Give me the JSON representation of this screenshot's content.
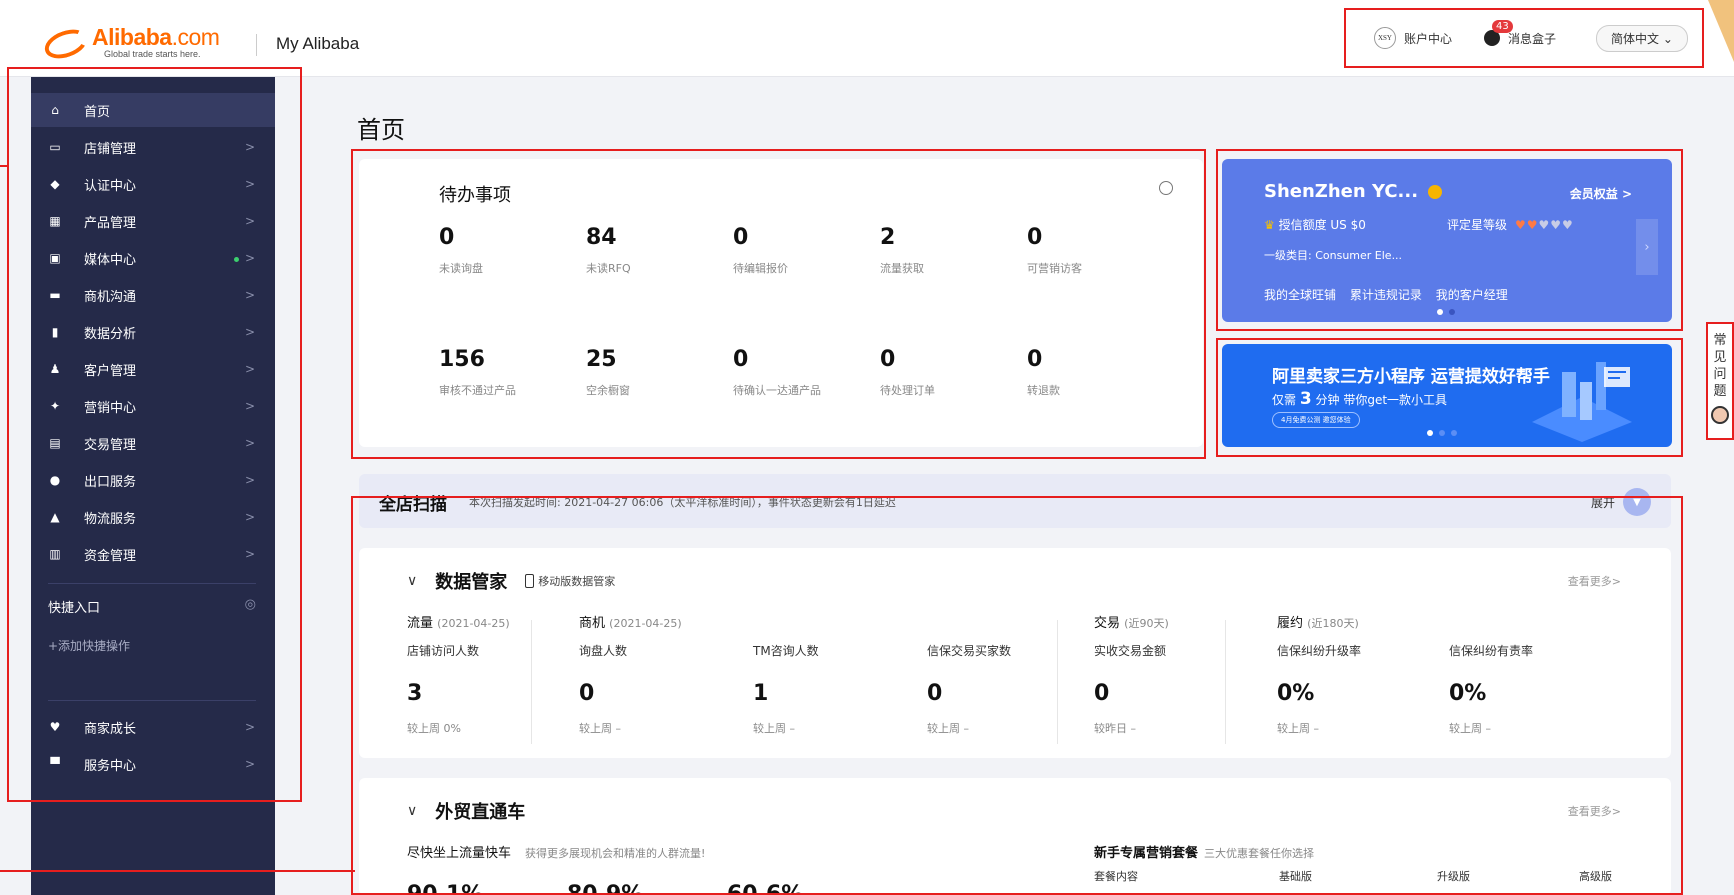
{
  "header": {
    "brand": "Alibaba",
    "brand_suffix": ".com",
    "slogan": "Global trade starts here.",
    "site_name": "My Alibaba",
    "account_avatar": "XSY",
    "account_label": "账户中心",
    "message_count": "43",
    "message_label": "消息盒子",
    "language": "简体中文"
  },
  "sidebar": {
    "items": [
      {
        "label": "首页",
        "icon": "home-icon",
        "glyph": "⌂"
      },
      {
        "label": "店铺管理",
        "icon": "store-icon",
        "glyph": "▭"
      },
      {
        "label": "认证中心",
        "icon": "shield-icon",
        "glyph": "◆"
      },
      {
        "label": "产品管理",
        "icon": "grid-icon",
        "glyph": "▦"
      },
      {
        "label": "媒体中心",
        "icon": "media-icon",
        "glyph": "▣"
      },
      {
        "label": "商机沟通",
        "icon": "chat-icon",
        "glyph": "▬"
      },
      {
        "label": "数据分析",
        "icon": "bar-chart-icon",
        "glyph": "▮"
      },
      {
        "label": "客户管理",
        "icon": "users-icon",
        "glyph": "♟"
      },
      {
        "label": "营销中心",
        "icon": "marketing-icon",
        "glyph": "✦"
      },
      {
        "label": "交易管理",
        "icon": "document-icon",
        "glyph": "▤"
      },
      {
        "label": "出口服务",
        "icon": "globe-icon",
        "glyph": "●"
      },
      {
        "label": "物流服务",
        "icon": "truck-icon",
        "glyph": "▲"
      },
      {
        "label": "资金管理",
        "icon": "bank-icon",
        "glyph": "▥"
      }
    ],
    "arrow": ">",
    "quick_title": "快捷入口",
    "quick_add": "+添加快捷操作",
    "bottom_items": [
      {
        "label": "商家成长",
        "icon": "heart-icon",
        "glyph": "♥"
      },
      {
        "label": "服务中心",
        "icon": "briefcase-icon",
        "glyph": "▀"
      }
    ]
  },
  "page": {
    "title": "首页"
  },
  "todo": {
    "title": "待办事项",
    "stats": [
      {
        "value": "0",
        "label": "未读询盘"
      },
      {
        "value": "84",
        "label": "未读RFQ"
      },
      {
        "value": "0",
        "label": "待编辑报价"
      },
      {
        "value": "2",
        "label": "流量获取"
      },
      {
        "value": "0",
        "label": "可营销访客"
      },
      {
        "value": "156",
        "label": "审核不通过产品"
      },
      {
        "value": "25",
        "label": "空余橱窗"
      },
      {
        "value": "0",
        "label": "待确认一达通产品"
      },
      {
        "value": "0",
        "label": "待处理订单"
      },
      {
        "value": "0",
        "label": "转退款"
      }
    ]
  },
  "member": {
    "name": "ShenZhen YC...",
    "benefits": "会员权益 >",
    "credit": "授信额度 US $0",
    "star_label": "评定星等级",
    "hearts": "♥♥♥♥♥",
    "category": "一级类目: Consumer Ele...",
    "links": [
      "我的全球旺铺",
      "累计违规记录",
      "我的客户经理"
    ]
  },
  "banner": {
    "title": "阿里卖家三方小程序 运营提效好帮手",
    "line_pre": "仅需",
    "line_num": "3",
    "line_post": "分钟 带你get一款小工具",
    "pill": "4月免费公测 邀您体验"
  },
  "faq": {
    "label": "常见问题"
  },
  "scan": {
    "title": "全店扫描",
    "subtitle": "本次扫描发起时间: 2021-04-27 06:06（太平洋标准时间），事件状态更新会有1日延迟",
    "expand": "展开"
  },
  "data_manager": {
    "title": "数据管家",
    "mobile_link": "移动版数据管家",
    "see_more": "查看更多>",
    "groups": [
      {
        "name": "流量",
        "date": "(2021-04-25)"
      },
      {
        "name": "商机",
        "date": "(2021-04-25)"
      },
      {
        "name": "交易",
        "date": "(近90天)"
      },
      {
        "name": "履约",
        "date": "(近180天)"
      }
    ],
    "metrics": [
      {
        "name": "店铺访问人数",
        "value": "3",
        "compare": "较上周 0%"
      },
      {
        "name": "询盘人数",
        "value": "0",
        "compare": "较上周 –"
      },
      {
        "name": "TM咨询人数",
        "value": "1",
        "compare": "较上周 –"
      },
      {
        "name": "信保交易买家数",
        "value": "0",
        "compare": "较上周 –"
      },
      {
        "name": "实收交易金额",
        "value": "0",
        "compare": "较昨日 –"
      },
      {
        "name": "信保纠纷升级率",
        "value": "0%",
        "compare": "较上周 –"
      },
      {
        "name": "信保纠纷有责率",
        "value": "0%",
        "compare": "较上周 –"
      }
    ]
  },
  "p4p": {
    "title": "外贸直通车",
    "see_more": "查看更多>",
    "left_title": "尽快坐上流量快车",
    "left_sub": "获得更多展现机会和精准的人群流量!",
    "right_title": "新手专属营销套餐",
    "right_sub": "三大优惠套餐任你选择",
    "pkg_cols": [
      "套餐内容",
      "基础版",
      "升级版",
      "高级版"
    ],
    "pcts": [
      "90.1%",
      "80.9%",
      "60.6%"
    ]
  }
}
